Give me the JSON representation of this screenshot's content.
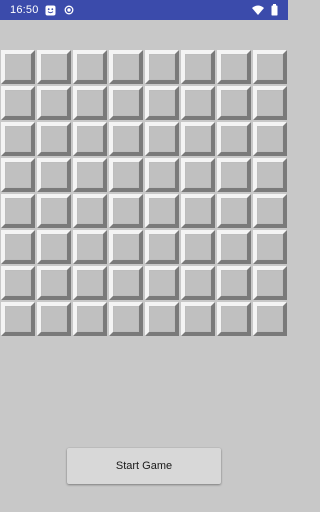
{
  "status_bar": {
    "time": "16:50",
    "icons_left": [
      "notification-face-icon",
      "record-dot-icon"
    ],
    "icons_right": [
      "wifi-icon",
      "battery-icon"
    ],
    "background": "#3b4bab"
  },
  "board": {
    "rows": 8,
    "columns": 8,
    "cell_state": "unrevealed",
    "cell_color": "#c0c0c0"
  },
  "controls": {
    "start_label": "Start Game"
  },
  "colors": {
    "background": "#c8c8c8",
    "button": "#d8d8d8"
  }
}
